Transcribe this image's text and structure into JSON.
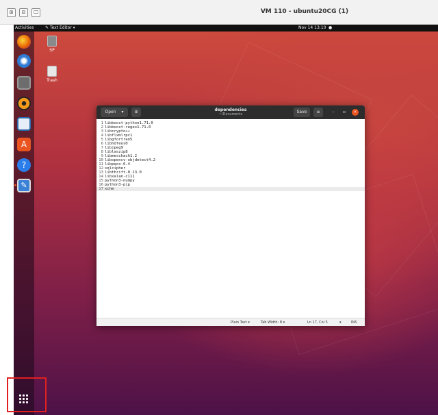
{
  "vm": {
    "title": "VM 110 - ubuntu20CG (1)",
    "buttons": [
      "⊞",
      "⊟",
      "🖵"
    ]
  },
  "topbar": {
    "activities": "Activities",
    "app_menu": "Text Editor",
    "app_menu_arrow": "▾",
    "clock": "Nov 14  13:10",
    "indicator": "●"
  },
  "desktop": {
    "icons": [
      {
        "label": "SP",
        "icon": "folder-icon"
      },
      {
        "label": "Trash",
        "icon": "trash-icon"
      }
    ]
  },
  "dock": {
    "apps": [
      {
        "name": "firefox-icon",
        "color": "#e66000"
      },
      {
        "name": "thunderbird-icon",
        "color": "#2f7bd4"
      },
      {
        "name": "files-icon",
        "color": "#6d6d6d"
      },
      {
        "name": "rhythmbox-icon",
        "color": "#f29a1b"
      },
      {
        "name": "libreoffice-writer-icon",
        "color": "#e8eef7"
      },
      {
        "name": "software-center-icon",
        "color": "#e95420"
      },
      {
        "name": "help-icon",
        "color": "#2b7de9"
      },
      {
        "name": "text-editor-icon",
        "color": "#3b82d6"
      }
    ]
  },
  "editor": {
    "open_label": "Open",
    "open_arrow": "▾",
    "title": "dependencies",
    "subtitle": "~/Documents",
    "save_label": "Save",
    "menu_icon": "≡",
    "minimize_icon": "–",
    "maximize_icon": "▫",
    "close_icon": "×",
    "lines": [
      "libboost-python1.71.0",
      "libboost-regex1.71.0",
      "libcrypto++",
      "libflxmlrpc1",
      "libgfortran5",
      "libhdfeos0",
      "libjpeg9",
      "liblaszip8",
      "libmeschach1.2",
      "libopencv-objdetect4.2",
      "libpqxx-6.4",
      "sqlcipher",
      "libthrift-0.13.0",
      "libxalan-c111",
      "python3-numpy",
      "python3-pip",
      "xchm"
    ],
    "line_numbers": [
      "1",
      "2",
      "3",
      "4",
      "5",
      "6",
      "7",
      "8",
      "9",
      "10",
      "11",
      "12",
      "13",
      "14",
      "15",
      "16",
      "17"
    ],
    "current_line": 17,
    "status": {
      "language": "Plain Text ▾",
      "tab_width": "Tab Width: 8 ▾",
      "position": "Ln 17, Col 5",
      "dropdown": "▾",
      "mode": "INS"
    }
  },
  "colors": {
    "highlight_box": "#e02020",
    "close_button": "#e95420"
  }
}
